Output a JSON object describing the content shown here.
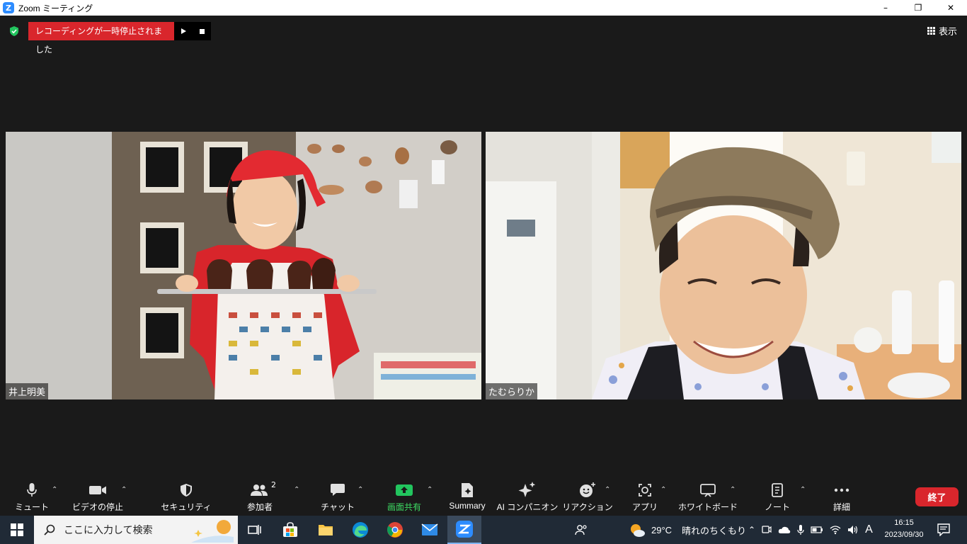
{
  "window": {
    "title": "Zoom ミーティング",
    "min": "–",
    "max": "❐",
    "close": "✕"
  },
  "recording": {
    "status": "レコーディングが一時停止されました"
  },
  "view": {
    "label": "表示"
  },
  "participants": [
    {
      "name": "井上明美"
    },
    {
      "name": "たむらりか"
    }
  ],
  "toolbar": {
    "mute": "ミュート",
    "video": "ビデオの停止",
    "security": "セキュリティ",
    "participants": "参加者",
    "participants_count": "2",
    "chat": "チャット",
    "share": "画面共有",
    "summary": "Summary",
    "ai": "AI コンパニオン",
    "reactions": "リアクション",
    "apps": "アプリ",
    "whiteboard": "ホワイトボード",
    "notes": "ノート",
    "more": "詳細",
    "end": "終了"
  },
  "taskbar": {
    "search_placeholder": "ここに入力して検索",
    "weather_temp": "29°C",
    "weather_text": "晴れのちくもり",
    "ime": "A",
    "time": "16:15",
    "date": "2023/09/30"
  },
  "colors": {
    "accent": "#2d8cff",
    "danger": "#d9262c",
    "share_green": "#22c55e"
  }
}
